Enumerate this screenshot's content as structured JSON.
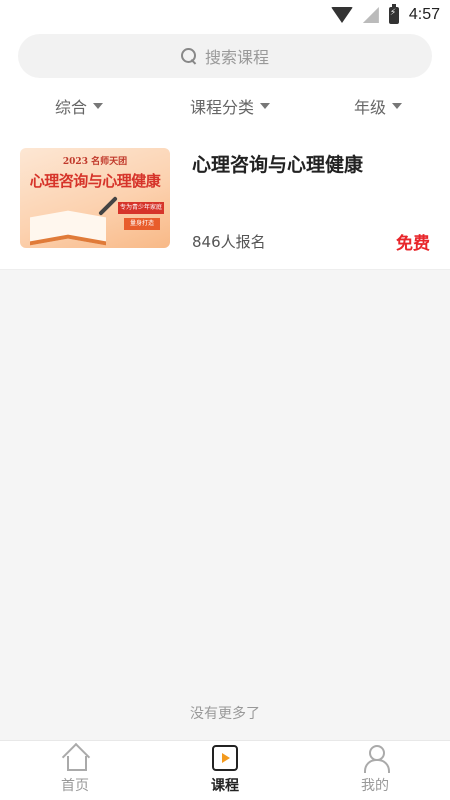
{
  "status_bar": {
    "time": "4:57",
    "icons": [
      "wifi-icon",
      "no-signal-icon",
      "battery-charging-icon"
    ]
  },
  "search": {
    "placeholder": "搜索课程",
    "icon": "search-icon"
  },
  "filters": [
    {
      "label": "综合"
    },
    {
      "label": "课程分类"
    },
    {
      "label": "年级"
    }
  ],
  "courses": [
    {
      "title": "心理咨询与心理健康",
      "enrolled": "846人报名",
      "price": "免费",
      "thumbnail": {
        "year_text": "2023 名师天团",
        "title_text": "心理咨询与心理健康",
        "tag1": "专为青少年家庭",
        "tag2": "量身打造"
      }
    }
  ],
  "list_footer": "没有更多了",
  "tab_bar": {
    "tabs": [
      {
        "label": "首页",
        "icon": "home-icon",
        "active": false
      },
      {
        "label": "课程",
        "icon": "course-icon",
        "active": true
      },
      {
        "label": "我的",
        "icon": "user-icon",
        "active": false
      }
    ]
  },
  "colors": {
    "price": "#e8262b",
    "accent": "#f39a1e",
    "background": "#f5f5f5"
  }
}
